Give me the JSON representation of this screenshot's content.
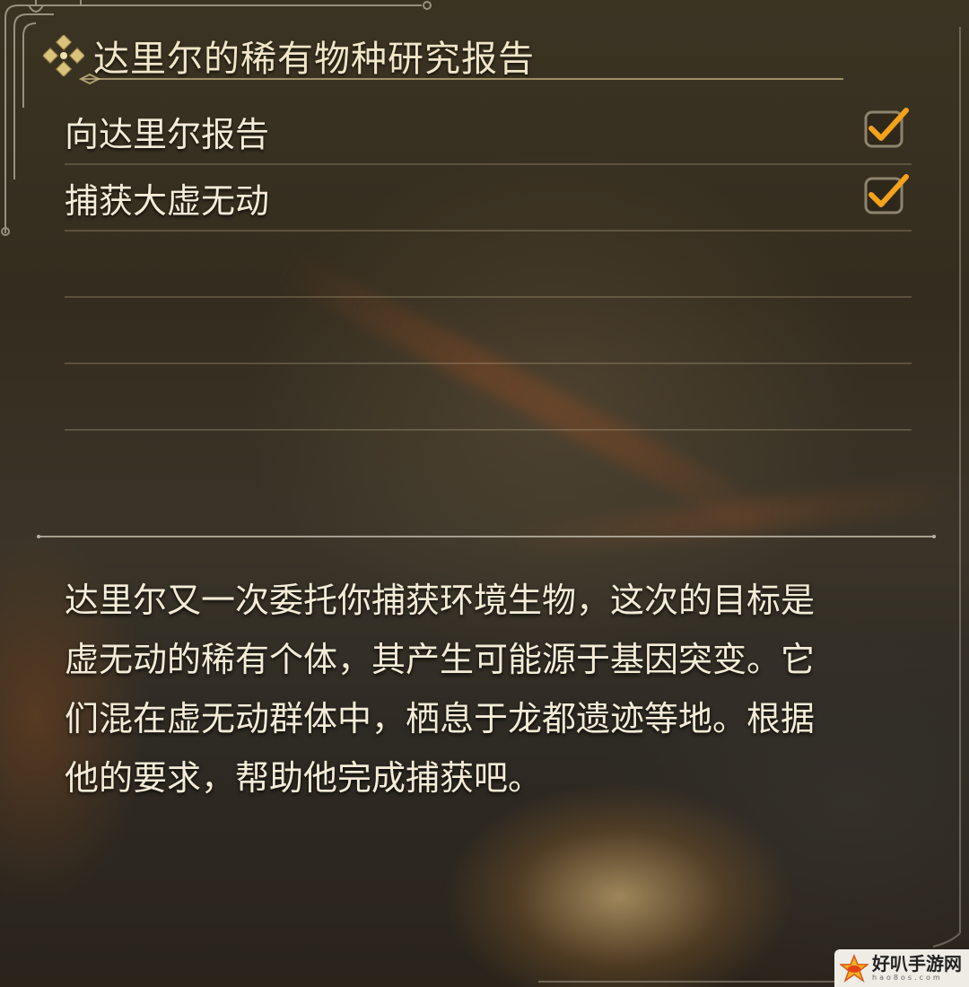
{
  "quest": {
    "title": "达里尔的稀有物种研究报告",
    "objectives": [
      {
        "label": "向达里尔报告",
        "completed": true
      },
      {
        "label": "捕获大虚无动",
        "completed": true
      },
      {
        "label": "",
        "completed": false
      },
      {
        "label": "",
        "completed": false
      },
      {
        "label": "",
        "completed": false
      }
    ],
    "description": "达里尔又一次委托你捕获环境生物，这次的目标是虚无动的稀有个体，其产生可能源于基因突变。它们混在虚无动群体中，栖息于龙都遗迹等地。根据他的要求，帮助他完成捕获吧。"
  },
  "watermark": {
    "name": "好叭手游网",
    "domain": "hao8os.com"
  },
  "icons": {
    "title": "quest-sparkle-icon",
    "check": "checkmark-icon",
    "watermark": "site-logo-icon"
  },
  "colors": {
    "gold": "#d9c27a",
    "check": "#f3a21a",
    "text": "#f4ecd8"
  }
}
